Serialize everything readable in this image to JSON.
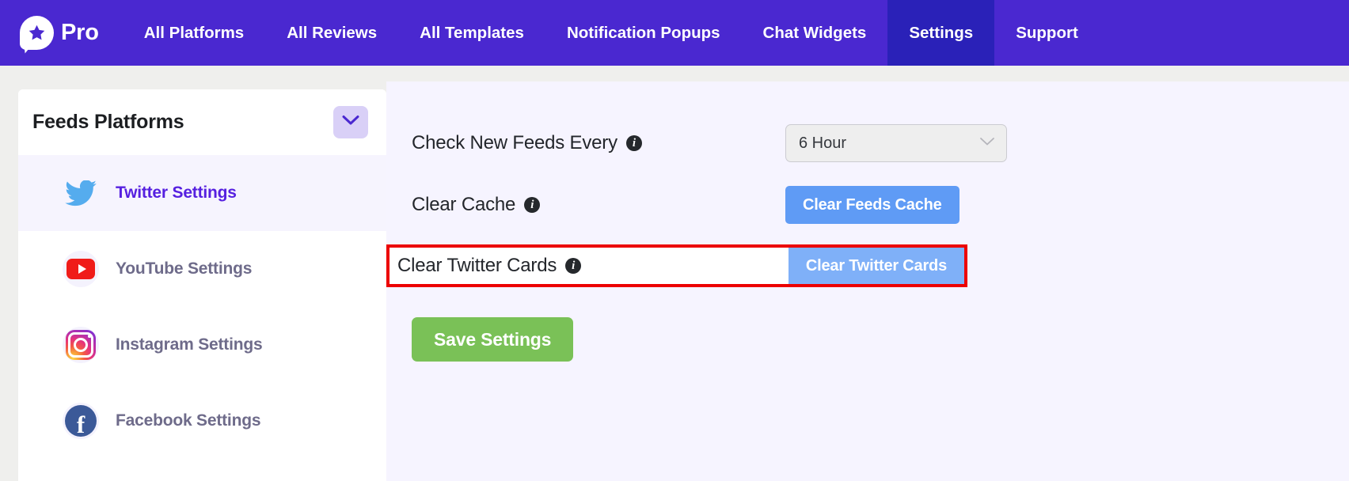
{
  "topnav": {
    "brand": {
      "name": "Pro",
      "logo_icon": "star-speech-bubble-logo"
    },
    "items": [
      {
        "label": "All Platforms",
        "active": false
      },
      {
        "label": "All Reviews",
        "active": false
      },
      {
        "label": "All Templates",
        "active": false
      },
      {
        "label": "Notification Popups",
        "active": false
      },
      {
        "label": "Chat Widgets",
        "active": false
      },
      {
        "label": "Settings",
        "active": true
      },
      {
        "label": "Support",
        "active": false
      }
    ],
    "background_color": "#4a28d0",
    "active_background_color": "#2a21b8"
  },
  "sidebar": {
    "title": "Feeds Platforms",
    "collapse_icon": "chevron-down-icon",
    "items": [
      {
        "label": "Twitter Settings",
        "icon": "twitter-icon",
        "active": true
      },
      {
        "label": "YouTube Settings",
        "icon": "youtube-icon",
        "active": false
      },
      {
        "label": "Instagram Settings",
        "icon": "instagram-icon",
        "active": false
      },
      {
        "label": "Facebook Settings",
        "icon": "facebook-icon",
        "active": false
      }
    ],
    "active_color": "#5620e0",
    "inactive_color": "#6e6b8a"
  },
  "main": {
    "rows": [
      {
        "label": "Check New Feeds Every",
        "info_icon": "info-icon",
        "control": "select",
        "value": "6 Hour",
        "chevron_icon": "chevron-down-icon"
      },
      {
        "label": "Clear Cache",
        "info_icon": "info-icon",
        "control": "button",
        "button_label": "Clear Feeds Cache"
      },
      {
        "label": "Clear Twitter Cards",
        "info_icon": "info-icon",
        "control": "button",
        "button_label": "Clear Twitter Cards",
        "highlighted": true,
        "highlight_color": "#ec0000"
      }
    ],
    "save_label": "Save Settings",
    "save_color": "#7ac157",
    "button_color": "#5f9bf5"
  }
}
